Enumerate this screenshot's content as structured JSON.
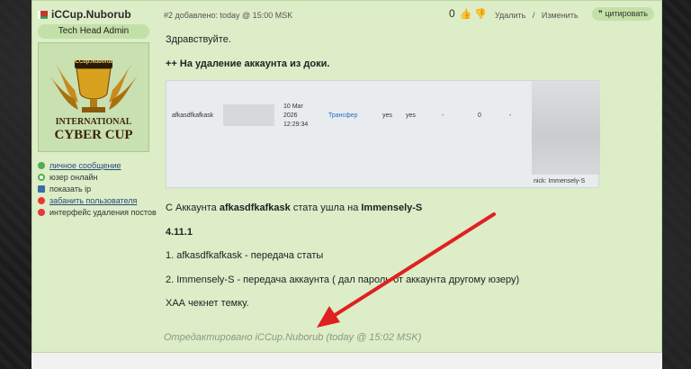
{
  "author": {
    "name": "iCCup.Nuborub",
    "role": "Tech Head Admin",
    "avatar_text": [
      "iCCup.Nuborub",
      "INTERNATIONAL",
      "CYBER CUP"
    ],
    "actions": [
      {
        "label": "личное сообщение",
        "icon": "message-icon",
        "color": "#4caf50",
        "link": true
      },
      {
        "label": "юзер онлайн",
        "icon": "online-icon",
        "color": "#4caf50",
        "link": false
      },
      {
        "label": "показать ip",
        "icon": "monitor-icon",
        "color": "#3b6ea8",
        "link": false
      },
      {
        "label": "забанить пользователя",
        "icon": "ban-icon",
        "color": "#e53935",
        "link": true
      },
      {
        "label": "интерфейс удаления постов",
        "icon": "delete-icon",
        "color": "#e53935",
        "link": false
      }
    ]
  },
  "post": {
    "meta": "#2 добавлено: today @ 15:00 MSK",
    "votes": "0",
    "delete_label": "Удалить",
    "separator": "/",
    "edit_label": "Изменить",
    "quote_label": "❞ цитировать",
    "greeting": "Здравствуйте.",
    "headline": "++ На удаление аккаунта из доки.",
    "table": {
      "account": "afkasdfkafkask",
      "date": [
        "10 Mar",
        "2026",
        "12:29:34"
      ],
      "type": "Трансфер",
      "col1": "yes",
      "col2": "yes",
      "col3": "-",
      "col4": "0",
      "col5": "-",
      "nick": "nick: Immensely-S"
    },
    "stats_pre": "С Аккаунта ",
    "stats_acc": "afkasdfkafkask",
    "stats_mid": " стата ушла на ",
    "stats_target": "Immensely-S",
    "rule": "4.11.1",
    "item1": "1. afkasdfkafkask - передача статы",
    "item2": "2. Immensely-S - передача аккаунта ( дал пароль от аккаунта другому юзеру)",
    "closing": "ХАА чекнет темку.",
    "edited": "Отредактировано iCCup.Nuborub (today @ 15:02 MSK)"
  },
  "colors": {
    "post_bg": "#dcedc8",
    "arrow": "#e02020",
    "link": "#1f6fc9"
  }
}
